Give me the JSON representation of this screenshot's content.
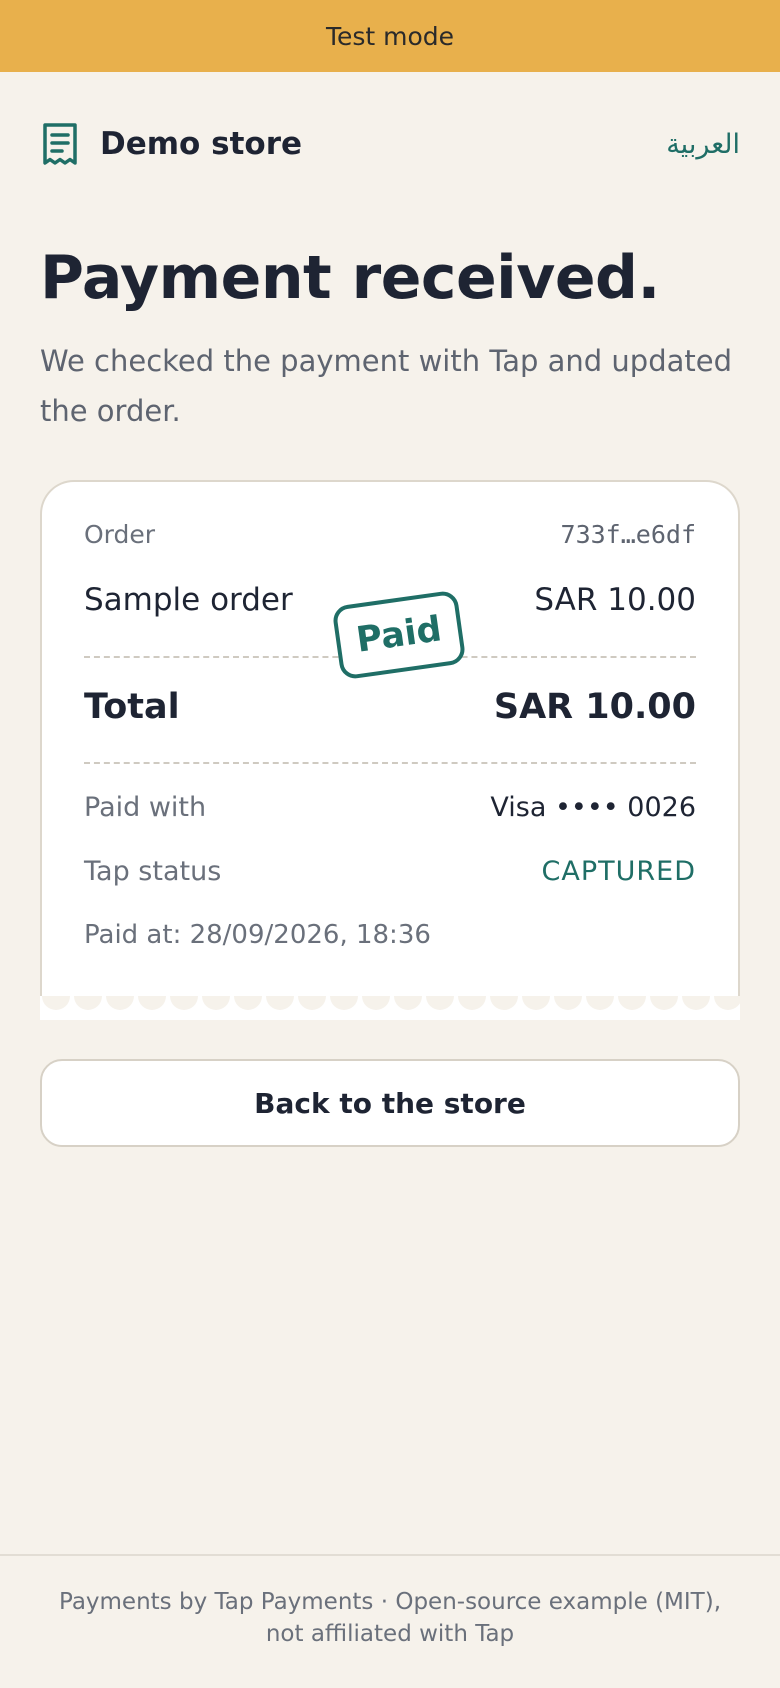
{
  "banner": {
    "text": "Test mode"
  },
  "header": {
    "store_name": "Demo store",
    "language_link": "العربية",
    "icon": "receipt-icon"
  },
  "main": {
    "title": "Payment received.",
    "subtitle": "We checked the payment with Tap and updated the order."
  },
  "receipt": {
    "order_label": "Order",
    "order_id": "733f…e6df",
    "item_name": "Sample order",
    "item_amount": "SAR 10.00",
    "stamp": "Paid",
    "total_label": "Total",
    "total_amount": "SAR 10.00",
    "paid_with_label": "Paid with",
    "paid_with_value": "Visa •••• 0026",
    "tap_status_label": "Tap status",
    "tap_status_value": "CAPTURED",
    "paid_at": "Paid at: 28/09/2026, 18:36"
  },
  "actions": {
    "back_label": "Back to the store"
  },
  "footer": {
    "text": "Payments by Tap Payments · Open-source example (MIT), not affiliated with Tap"
  },
  "colors": {
    "banner": "#e8b04c",
    "background": "#f6f2eb",
    "accent": "#1f6e66",
    "text": "#1e2433",
    "muted": "#6a707b"
  }
}
